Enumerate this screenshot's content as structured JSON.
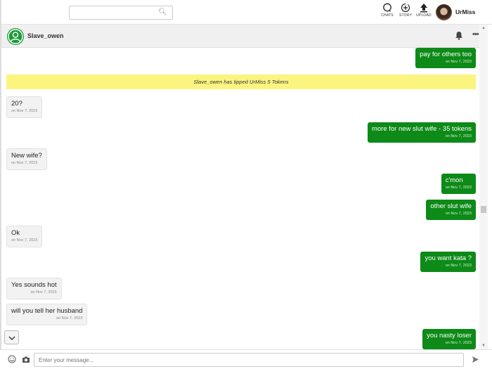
{
  "topbar": {
    "search": {
      "value": "",
      "placeholder": ""
    },
    "nav": [
      {
        "label": "CHATS",
        "icon": "chat-bubble-icon"
      },
      {
        "label": "STORY",
        "icon": "story-plus-icon"
      },
      {
        "label": "UPLOAD",
        "icon": "upload-icon"
      }
    ],
    "user": {
      "name": "UrMiss"
    }
  },
  "chat": {
    "contact_name": "Slave_owen",
    "colors": {
      "outgoing": "#0d8a18",
      "incoming": "#f2f2f2",
      "tip": "#fbf580"
    },
    "tip_banner": "Slave_owen has tipped UrMiss 5 Tokens",
    "messages": [
      {
        "dir": "out",
        "text": "pay for others too",
        "time": "on Nov 7, 2023"
      },
      {
        "dir": "in",
        "text": "20?",
        "time": "on Nov 7, 2023"
      },
      {
        "dir": "out",
        "text": "more for new slut wife - 35 tokens",
        "time": "on Nov 7, 2023"
      },
      {
        "dir": "in",
        "text": "New wife?",
        "time": "on Nov 7, 2023"
      },
      {
        "dir": "out",
        "text": "c'mon",
        "time": "on Nov 7, 2023"
      },
      {
        "dir": "out",
        "text": "other slut wife",
        "time": "on Nov 7, 2023"
      },
      {
        "dir": "in",
        "text": "Ok",
        "time": "on Nov 7, 2023"
      },
      {
        "dir": "out",
        "text": "you want kata ?",
        "time": "on Nov 7, 2023"
      },
      {
        "dir": "in",
        "text": "Yes sounds hot",
        "time": "on Nov 7, 2023"
      },
      {
        "dir": "in",
        "text": "will you tell her husband",
        "time": "on Nov 7, 2023"
      },
      {
        "dir": "out",
        "text": "you nasty loser",
        "time": "on Nov 7, 2023"
      }
    ]
  },
  "composer": {
    "placeholder": "Enter your message..."
  }
}
